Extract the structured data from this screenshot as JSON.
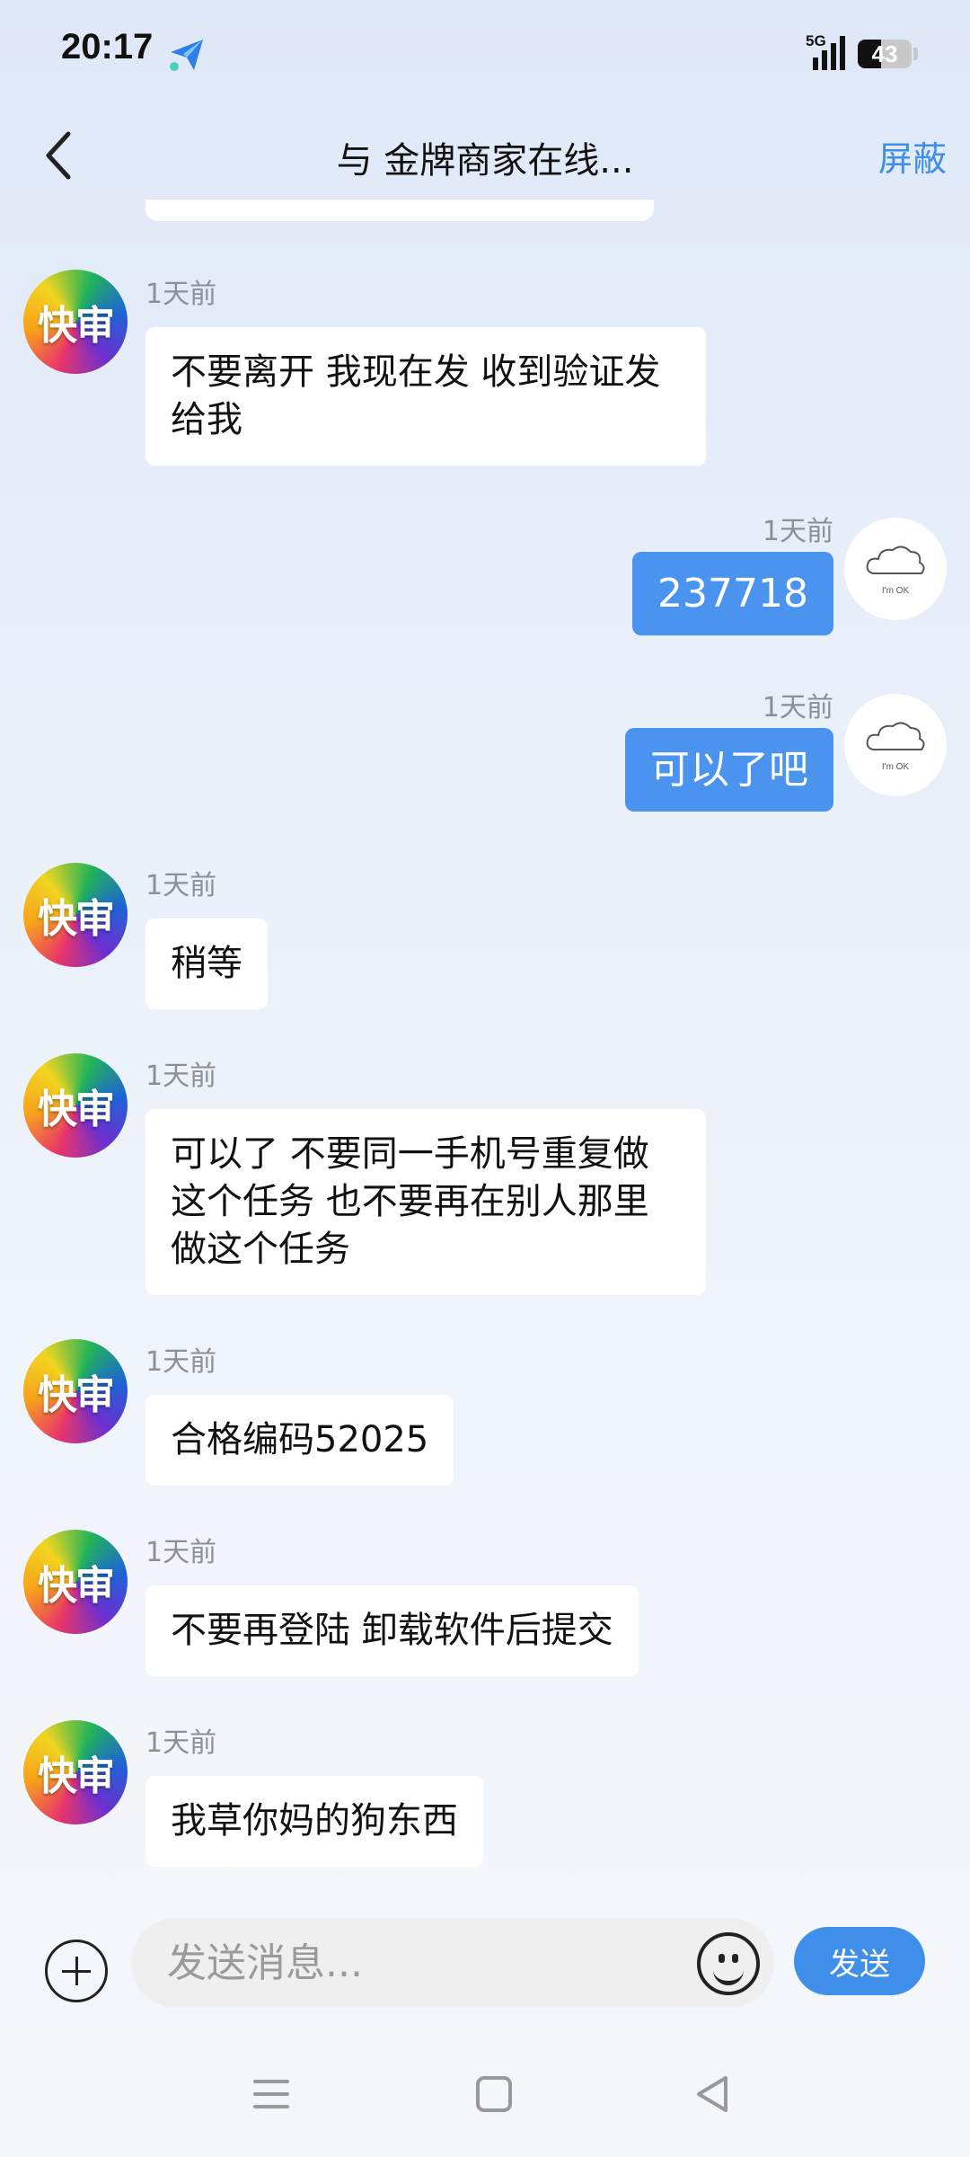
{
  "status_bar": {
    "time": "20:17",
    "network": "5G",
    "battery_level": "43",
    "battery_percent": 43,
    "app_icon": "paper-plane-icon"
  },
  "header": {
    "title": "与 金牌商家在线...",
    "block_label": "屏蔽",
    "back_icon": "chevron-left-icon"
  },
  "avatars": {
    "merchant_text": "快审",
    "self_caption": "I'm OK"
  },
  "messages": [
    {
      "direction": "in",
      "time": "1天前",
      "text": "不要离开 我现在发 收到验证发给我"
    },
    {
      "direction": "out",
      "time": "1天前",
      "text": "237718"
    },
    {
      "direction": "out",
      "time": "1天前",
      "text": "可以了吧"
    },
    {
      "direction": "in",
      "time": "1天前",
      "text": "稍等"
    },
    {
      "direction": "in",
      "time": "1天前",
      "text": "可以了 不要同一手机号重复做这个任务 也不要再在别人那里做这个任务"
    },
    {
      "direction": "in",
      "time": "1天前",
      "text": "合格编码52025"
    },
    {
      "direction": "in",
      "time": "1天前",
      "text": "不要再登陆 卸载软件后提交"
    },
    {
      "direction": "in",
      "time": "1天前",
      "text": "我草你妈的狗东西"
    }
  ],
  "input_bar": {
    "placeholder": "发送消息...",
    "send_label": "发送",
    "plus_icon": "plus-circle-icon",
    "emoji_icon": "smiley-icon"
  },
  "nav_bar": {
    "menu_icon": "menu-icon",
    "home_icon": "home-square-icon",
    "back_icon": "back-triangle-icon"
  },
  "colors": {
    "accent": "#3f8ee9",
    "outgoing_bubble": "#4a94f0",
    "incoming_bubble": "#ffffff",
    "timestamp": "#8a8f98"
  }
}
